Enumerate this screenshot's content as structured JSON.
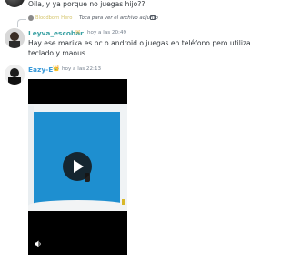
{
  "messages": [
    {
      "text": "Oila, y ya porque no juegas hijo??"
    },
    {
      "reply": {
        "author": "Bloodborn Hero",
        "text": "Toca para ver el archivo adjunto"
      },
      "author": "Leyva_escobar",
      "badge": "✉",
      "time": "hoy a las 20:49",
      "text": "Hay ese marika es pc o android o juegas en teléfono pero utiliza teclado y maous"
    },
    {
      "author": "Eazy-E",
      "badge": "👑",
      "time": "hoy a las 22:13",
      "attachment": {
        "type": "video"
      }
    }
  ],
  "colors": {
    "author_2": "#3aa1a3",
    "author_3": "#3a9ad9",
    "video_water": "#1e8fd0"
  }
}
